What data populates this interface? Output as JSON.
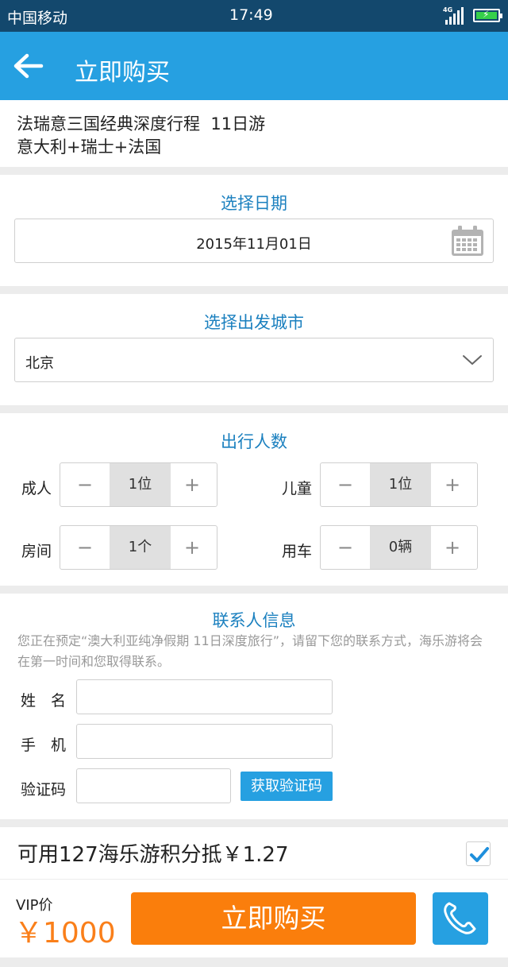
{
  "status_bar": {
    "carrier": "中国移动",
    "time": "17:49",
    "network": "4G"
  },
  "app_bar": {
    "title": "立即购买"
  },
  "product": {
    "name": "法瑞意三国经典深度行程  11日游",
    "route": "意大利+瑞士+法国"
  },
  "date_section": {
    "title": "选择日期",
    "value": "2015年11月01日"
  },
  "city_section": {
    "title": "选择出发城市",
    "value": "北京"
  },
  "travelers": {
    "title": "出行人数",
    "minus": "−",
    "plus": "+",
    "rows": [
      {
        "label": "成人",
        "value": "1位"
      },
      {
        "label": "儿童",
        "value": "1位"
      },
      {
        "label": "房间",
        "value": "1个"
      },
      {
        "label": "用车",
        "value": "0辆"
      }
    ]
  },
  "contact": {
    "title": "联系人信息",
    "note": "您正在预定“澳大利亚纯净假期 11日深度旅行”，请留下您的联系方式，海乐游将会在第一时间和您取得联系。",
    "name_label": "姓　名",
    "phone_label": "手　机",
    "code_label": "验证码",
    "code_button": "获取验证码"
  },
  "points": {
    "text": "可用127海乐游积分抵￥1.27",
    "checked": true
  },
  "footer": {
    "vip_label": "VIP价",
    "price": "￥1000",
    "buy_label": "立即购买"
  },
  "colors": {
    "primary": "#26a0e1",
    "accent": "#fa7e0c",
    "section_title": "#1b80bf",
    "status_bar": "#13486d"
  }
}
